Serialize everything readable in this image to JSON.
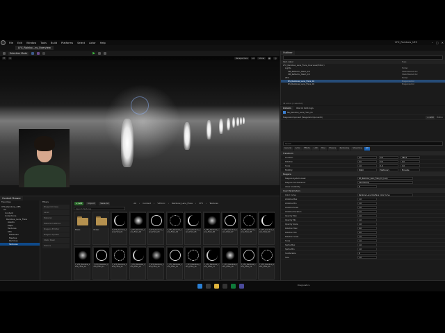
{
  "window": {
    "title": "VFX_Rainbow_UE5",
    "menu": [
      "File",
      "Edit",
      "Window",
      "Tools",
      "Build",
      "Platforms",
      "Select",
      "Actor",
      "Help"
    ],
    "doc_tab": "LFX_Rainbo...ns_Overview"
  },
  "toolbar": {
    "mode": "Selection Mode",
    "play": "▶",
    "perspective": "Perspective",
    "lit": "Lit",
    "show": "Show"
  },
  "outliner": {
    "tab": "Outliner",
    "col_label": "Item Label",
    "col_type": "Type",
    "rows": [
      {
        "label": "LFX_Rainbow_Lens_Flare_Overview(Editor)",
        "type": "",
        "sel": false
      },
      {
        "label": "Lights",
        "type": "Folder",
        "sel": false
      },
      {
        "label": "SM_Reflectiv_Mesh_1B",
        "type": "StaticMeshActor",
        "sel": false
      },
      {
        "label": "SM_Reflectiv_Mesh_1B",
        "type": "StaticMeshActor",
        "sel": false
      },
      {
        "label": "VFX",
        "type": "Folder",
        "sel": false
      },
      {
        "label": "NS_Rainbow_Lens_Flare_01",
        "type": "NiagaraActor",
        "sel": true
      },
      {
        "label": "NS_Rainbow_Lens_Flare_02",
        "type": "NiagaraActor",
        "sel": false
      }
    ],
    "footer": "38 actors (1 selected)"
  },
  "details": {
    "tab": "Details",
    "tab2": "World Settings",
    "actor_name": "NS_Rainbow_Lens_Flare_01",
    "component": "NiagaraComponent (NiagaraComponent0)",
    "add": "+ Add",
    "edit_in": "Edit in",
    "search_placeholder": "Search",
    "filter_tabs": [
      "General",
      "Actor",
      "Effects",
      "LOD",
      "Misc",
      "Physics",
      "Rendering",
      "Streaming",
      "All"
    ],
    "sections": {
      "transform": "Transform",
      "niagara": "Niagara",
      "user_params": "User Parameters",
      "niagara_utilities": "Niagara Utilities"
    },
    "transform_rows": [
      {
        "k": "Location",
        "v": [
          "0.0",
          "0.0",
          "380.0"
        ]
      },
      {
        "k": "Rotation",
        "v": [
          "0.0",
          "0.0",
          "0.0"
        ]
      },
      {
        "k": "Scale",
        "v": [
          "1.0",
          "1.0",
          "1.0"
        ]
      },
      {
        "k": "Mobility",
        "v": [
          "Static",
          "Stationary",
          "Movable"
        ]
      }
    ],
    "niagara_rows": [
      {
        "k": "Niagara System Asset",
        "v": "NS_Rainbow_Lens_Flare_01_Loop"
      },
      {
        "k": "Niagara Tick Behavior",
        "v": "Use Prereqs"
      },
      {
        "k": "Allow Scalability",
        "v": "☑"
      }
    ],
    "user_rows": [
      {
        "k": "Color Curve",
        "v": "Rainbow Lens Interface Color Curve"
      },
      {
        "k": "Lifetime Max",
        "v": "1.0"
      },
      {
        "k": "Lifetime Min",
        "v": "1.0"
      },
      {
        "k": "Lifetime Scale",
        "v": "1.0"
      },
      {
        "k": "Lifetime Duration",
        "v": "1.0"
      },
      {
        "k": "Opacity Max",
        "v": "1.0"
      },
      {
        "k": "Opacity Min",
        "v": "1.0"
      },
      {
        "k": "Opacity Scale",
        "v": "1.0"
      },
      {
        "k": "Rotation Max",
        "v": "0.0"
      },
      {
        "k": "Rotation Min",
        "v": "0.0"
      },
      {
        "k": "Rotation Scale",
        "v": "1.0"
      },
      {
        "k": "Scale",
        "v": "1.0"
      },
      {
        "k": "Sprite Max",
        "v": "1.0"
      },
      {
        "k": "Sprite Min",
        "v": "1.0"
      },
      {
        "k": "Scatterable",
        "v": "☑"
      },
      {
        "k": "Size",
        "v": "1.0"
      }
    ]
  },
  "content_browser": {
    "tab": "Content Drawer",
    "favorites": "Favorites",
    "project": "VFX_Rainbow_UE5",
    "tree": [
      "All",
      "Content",
      "Collections",
      "Rainbow_Lens_Flare",
      "Assets",
      "Maps",
      "Textures",
      "VFX",
      "Materials",
      "Meshes",
      "Particles",
      "Textures"
    ],
    "filters_title": "Filters",
    "filters": [
      "Blueprint Class",
      "Level",
      "Material",
      "Material Instance",
      "Niagara Emitter",
      "Niagara System",
      "Static Mesh",
      "Texture"
    ],
    "add": "+ Add",
    "import": "Import",
    "save_all": "Save All",
    "breadcrumb": [
      "All",
      "Content",
      "Vdfonic",
      "Rainbow_Lens_Flare",
      "VFX",
      "Textures"
    ],
    "search_placeholder": "Search Textures",
    "assets": [
      {
        "name": "Masks",
        "folder": true
      },
      {
        "name": "Noises",
        "folder": true
      },
      {
        "name": "T_VFX_Rainbow_Lens_Flare_01",
        "folder": false,
        "ring": "#ccc"
      },
      {
        "name": "T_VFX_Rainbow_Lens_Flare_02",
        "folder": false,
        "ring": "#eee"
      },
      {
        "name": "T_VFX_Rainbow_Lens_Flare_03",
        "folder": false,
        "ring": "#ddd"
      },
      {
        "name": "T_VFX_Rainbow_Lens_Flare_04",
        "folder": false,
        "ring": "#bbb"
      },
      {
        "name": "T_VFX_Rainbow_Lens_Flare_05",
        "folder": false,
        "ring": "#eee"
      },
      {
        "name": "T_VFX_Rainbow_Lens_Flare_06",
        "folder": false,
        "ring": "#ccc"
      },
      {
        "name": "T_VFX_Rainbow_Lens_Flare_07",
        "folder": false,
        "ring": "#ddd"
      },
      {
        "name": "T_VFX_Rainbow_Lens_Flare_08",
        "folder": false,
        "ring": "#bbb"
      },
      {
        "name": "T_VFX_Rainbow_Lens_Flare_09",
        "folder": false,
        "ring": "#eee"
      },
      {
        "name": "T_VFX_Rainbow_Lens_Flare_10",
        "folder": false,
        "ring": "#ccc"
      },
      {
        "name": "T_VFX_Rainbow_Lens_Flare_11",
        "folder": false,
        "ring": "#ddd"
      },
      {
        "name": "T_VFX_Rainbow_Lens_Flare_12",
        "folder": false,
        "ring": "#eee"
      },
      {
        "name": "T_VFX_Rainbow_Lens_Flare_13",
        "folder": false,
        "ring": "#ccc"
      },
      {
        "name": "T_VFX_Rainbow_Lens_Flare_14",
        "folder": false,
        "ring": "#bbb"
      },
      {
        "name": "T_VFX_Rainbow_Lens_Flare_15",
        "folder": false,
        "ring": "#ddd"
      },
      {
        "name": "T_VFX_Rainbow_Lens_Flare_16",
        "folder": false,
        "ring": "#eee"
      },
      {
        "name": "T_VFX_Rainbow_Lens_Flare_17",
        "folder": false,
        "ring": "#ccc"
      },
      {
        "name": "T_VFX_Rainbow_Lens_Flare_18",
        "folder": false,
        "ring": "#ddd"
      },
      {
        "name": "T_VFX_Rainbow_Lens_Flare_19",
        "folder": false,
        "ring": "#bbb"
      },
      {
        "name": "T_VFX_Rainbow_Lens_Flare_20",
        "folder": false,
        "ring": "#eee"
      }
    ],
    "item_count": "22 items",
    "collections": "Collections"
  },
  "status_bar": {
    "content_drawer": "Content Drawer",
    "output_log": "Output Log",
    "cmd": "Cmd",
    "derived": "Derived Data",
    "source": "Source Control",
    "all_saved": "All Saved",
    "revision": "Revision Control",
    "trace": "Trace",
    "diagnostics": "Diagnostics"
  },
  "colors": {
    "accent": "#1b63b5",
    "selection": "#264c78",
    "green": "#2d6a2d"
  }
}
